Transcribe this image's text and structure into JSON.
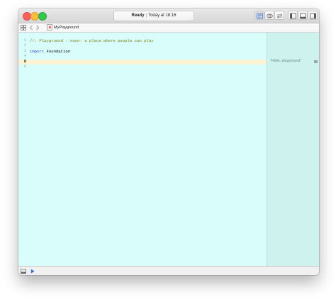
{
  "titlebar": {
    "status": "Ready",
    "separator": "|",
    "time": "Today at 18:16"
  },
  "jumpbar": {
    "file_name": "MyPlayground"
  },
  "editor": {
    "lines": [
      {
        "number": "1",
        "text": "//: Playground - noun: a place where people can play",
        "kind": "comment"
      },
      {
        "number": "2",
        "text": "",
        "kind": "plain"
      },
      {
        "number": "3",
        "keyword": "import",
        "text": "Foundation",
        "kind": "import"
      },
      {
        "number": "4",
        "text": "",
        "kind": "plain"
      },
      {
        "number": "5",
        "text": "",
        "kind": "current"
      },
      {
        "number": "6",
        "text": "",
        "kind": "plain"
      }
    ]
  },
  "results": {
    "value": "\"Hello, playground\""
  },
  "colors": {
    "editor_background": "#d9fdfa",
    "results_background": "#cef3ee",
    "comment": "#807c0c",
    "keyword": "#2f3fbf",
    "current_line": "#faf3d4"
  },
  "icons": [
    "close-button",
    "minimize-button",
    "zoom-button",
    "standard-editor-icon",
    "assistant-editor-icon",
    "version-editor-icon",
    "navigator-toggle-icon",
    "debug-area-toggle-icon",
    "utilities-toggle-icon",
    "grid-icon",
    "chevron-left-icon",
    "chevron-right-icon",
    "swift-file-icon",
    "console-toggle-icon",
    "run-icon",
    "quick-look-icon"
  ]
}
